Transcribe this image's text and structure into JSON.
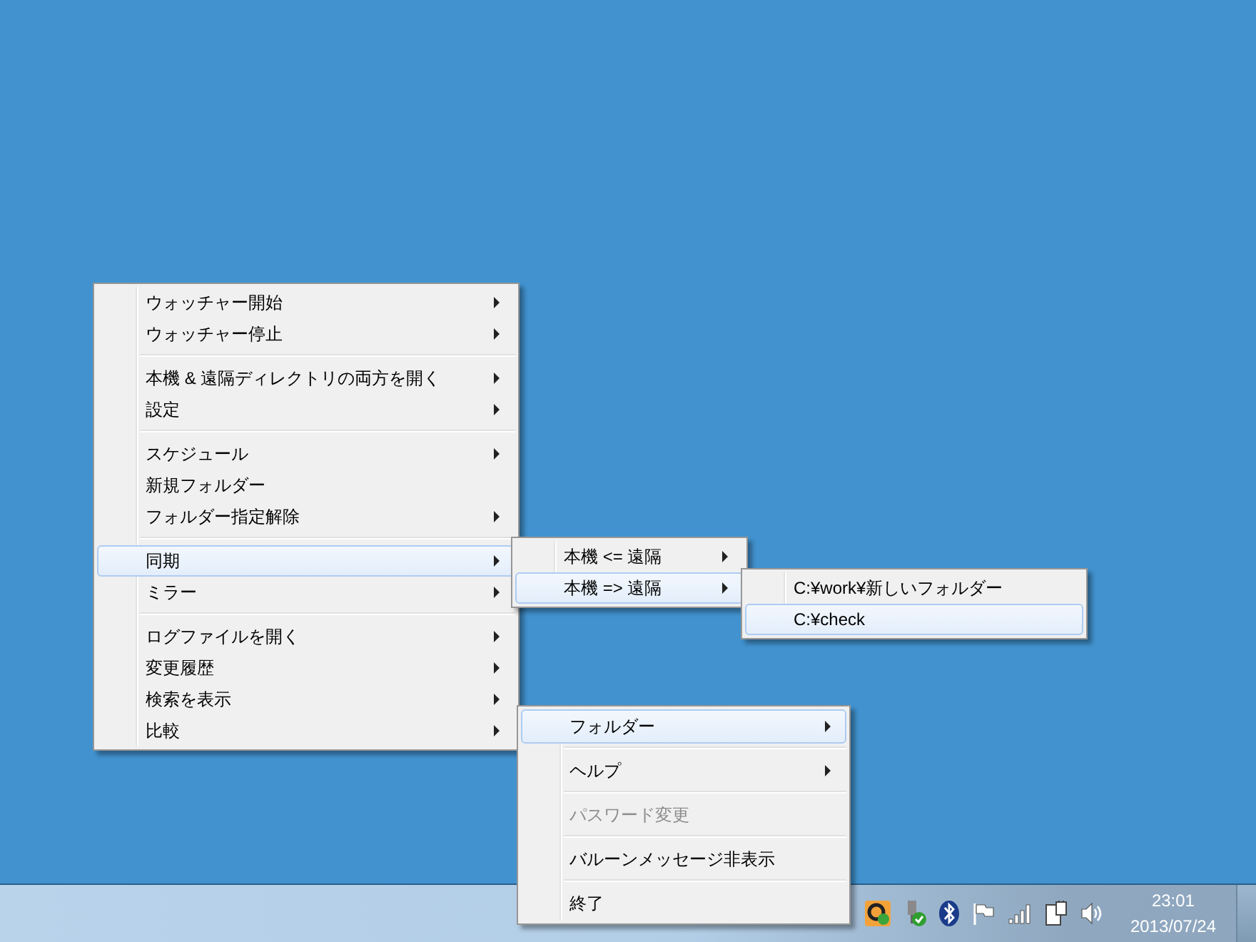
{
  "menus": [
    {
      "items": [
        {
          "kind": "item",
          "label": "ウォッチャー開始",
          "has_submenu": true,
          "selected": false,
          "disabled": false
        },
        {
          "kind": "item",
          "label": "ウォッチャー停止",
          "has_submenu": true,
          "selected": false,
          "disabled": false
        },
        {
          "kind": "separator"
        },
        {
          "kind": "item",
          "label": "本機 & 遠隔ディレクトリの両方を開く",
          "has_submenu": true,
          "selected": false,
          "disabled": false
        },
        {
          "kind": "item",
          "label": "設定",
          "has_submenu": true,
          "selected": false,
          "disabled": false
        },
        {
          "kind": "separator"
        },
        {
          "kind": "item",
          "label": "スケジュール",
          "has_submenu": true,
          "selected": false,
          "disabled": false
        },
        {
          "kind": "item",
          "label": "新規フォルダー",
          "has_submenu": false,
          "selected": false,
          "disabled": false
        },
        {
          "kind": "item",
          "label": "フォルダー指定解除",
          "has_submenu": true,
          "selected": false,
          "disabled": false
        },
        {
          "kind": "separator"
        },
        {
          "kind": "item",
          "label": "同期",
          "has_submenu": true,
          "selected": true,
          "disabled": false
        },
        {
          "kind": "item",
          "label": "ミラー",
          "has_submenu": true,
          "selected": false,
          "disabled": false
        },
        {
          "kind": "separator"
        },
        {
          "kind": "item",
          "label": "ログファイルを開く",
          "has_submenu": true,
          "selected": false,
          "disabled": false
        },
        {
          "kind": "item",
          "label": "変更履歴",
          "has_submenu": true,
          "selected": false,
          "disabled": false
        },
        {
          "kind": "item",
          "label": "検索を表示",
          "has_submenu": true,
          "selected": false,
          "disabled": false
        },
        {
          "kind": "item",
          "label": "比較",
          "has_submenu": true,
          "selected": false,
          "disabled": false
        }
      ]
    },
    {
      "items": [
        {
          "kind": "item",
          "label": "本機 <= 遠隔",
          "has_submenu": true,
          "selected": false,
          "disabled": false
        },
        {
          "kind": "item",
          "label": "本機 => 遠隔",
          "has_submenu": true,
          "selected": true,
          "disabled": false
        }
      ]
    },
    {
      "items": [
        {
          "kind": "item",
          "label": "C:¥work¥新しいフォルダー",
          "has_submenu": false,
          "selected": false,
          "disabled": false
        },
        {
          "kind": "item",
          "label": "C:¥check",
          "has_submenu": false,
          "selected": true,
          "disabled": false
        }
      ]
    },
    {
      "items": [
        {
          "kind": "item",
          "label": "フォルダー",
          "has_submenu": true,
          "selected": true,
          "disabled": false
        },
        {
          "kind": "separator"
        },
        {
          "kind": "item",
          "label": "ヘルプ",
          "has_submenu": true,
          "selected": false,
          "disabled": false
        },
        {
          "kind": "separator"
        },
        {
          "kind": "item",
          "label": "パスワード変更",
          "has_submenu": false,
          "selected": false,
          "disabled": true
        },
        {
          "kind": "separator"
        },
        {
          "kind": "item",
          "label": "バルーンメッセージ非表示",
          "has_submenu": false,
          "selected": false,
          "disabled": false
        },
        {
          "kind": "separator"
        },
        {
          "kind": "item",
          "label": "終了",
          "has_submenu": false,
          "selected": false,
          "disabled": false
        }
      ]
    }
  ],
  "taskbar": {
    "clock": {
      "time": "23:01",
      "date": "2013/07/24"
    }
  }
}
